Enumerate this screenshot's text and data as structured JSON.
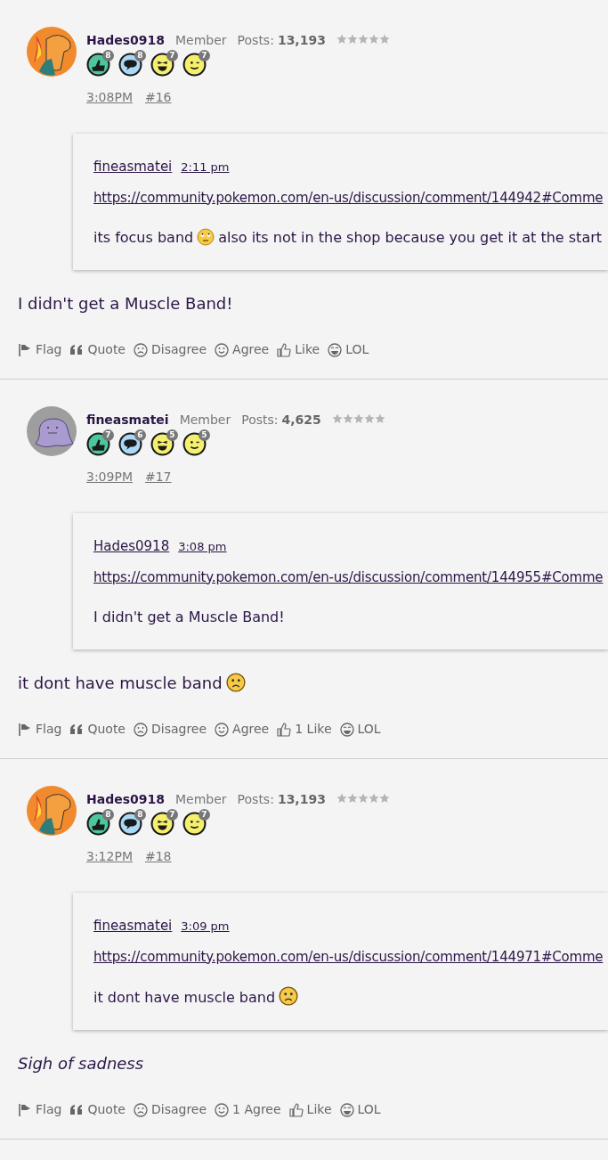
{
  "posts": [
    {
      "author": "Hades0918",
      "avatar": {
        "kind": "dragon"
      },
      "role": "Member",
      "posts_label": "Posts:",
      "posts_count": "13,193",
      "stars": 0,
      "badges": [
        {
          "kind": "thumb",
          "count": "8"
        },
        {
          "kind": "chat",
          "count": "8"
        },
        {
          "kind": "laugh",
          "count": "7"
        },
        {
          "kind": "wink",
          "count": "7"
        }
      ],
      "time": "3:08PM",
      "number": "#16",
      "quote": {
        "author": "fineasmatei",
        "time": "2:11 pm",
        "link": "https://community.pokemon.com/en-us/discussion/comment/144942#Comme",
        "segments": [
          {
            "kind": "text",
            "text": "its focus band"
          },
          {
            "kind": "eyeroll"
          },
          {
            "kind": "text",
            "text": "also its not in the shop because you get it at the start"
          }
        ]
      },
      "body": {
        "italic": false,
        "segments": [
          {
            "kind": "text",
            "text": "I didn't get a Muscle Band!"
          }
        ]
      },
      "actions": [
        {
          "kind": "flag",
          "label": "Flag"
        },
        {
          "kind": "quote",
          "label": "Quote"
        },
        {
          "kind": "disagree",
          "label": "Disagree"
        },
        {
          "kind": "agree",
          "label": "Agree"
        },
        {
          "kind": "like",
          "label": "Like"
        },
        {
          "kind": "lol",
          "label": "LOL"
        }
      ]
    },
    {
      "author": "fineasmatei",
      "avatar": {
        "kind": "blob"
      },
      "role": "Member",
      "posts_label": "Posts:",
      "posts_count": "4,625",
      "stars": 0,
      "badges": [
        {
          "kind": "thumb",
          "count": "7"
        },
        {
          "kind": "chat",
          "count": "6"
        },
        {
          "kind": "laugh",
          "count": "5"
        },
        {
          "kind": "wink",
          "count": "5"
        }
      ],
      "time": "3:09PM",
      "number": "#17",
      "quote": {
        "author": "Hades0918",
        "time": "3:08 pm",
        "link": "https://community.pokemon.com/en-us/discussion/comment/144955#Comme",
        "segments": [
          {
            "kind": "text",
            "text": "I didn't get a Muscle Band!"
          }
        ]
      },
      "body": {
        "italic": false,
        "segments": [
          {
            "kind": "text",
            "text": "it dont have muscle band"
          },
          {
            "kind": "sad"
          }
        ]
      },
      "actions": [
        {
          "kind": "flag",
          "label": "Flag"
        },
        {
          "kind": "quote",
          "label": "Quote"
        },
        {
          "kind": "disagree",
          "label": "Disagree"
        },
        {
          "kind": "agree",
          "label": "Agree"
        },
        {
          "kind": "like",
          "label": "1 Like"
        },
        {
          "kind": "lol",
          "label": "LOL"
        }
      ]
    },
    {
      "author": "Hades0918",
      "avatar": {
        "kind": "dragon"
      },
      "role": "Member",
      "posts_label": "Posts:",
      "posts_count": "13,193",
      "stars": 0,
      "badges": [
        {
          "kind": "thumb",
          "count": "8"
        },
        {
          "kind": "chat",
          "count": "8"
        },
        {
          "kind": "laugh",
          "count": "7"
        },
        {
          "kind": "wink",
          "count": "7"
        }
      ],
      "time": "3:12PM",
      "number": "#18",
      "quote": {
        "author": "fineasmatei",
        "time": "3:09 pm",
        "link": "https://community.pokemon.com/en-us/discussion/comment/144971#Comme",
        "segments": [
          {
            "kind": "text",
            "text": "it dont have muscle band"
          },
          {
            "kind": "sad"
          }
        ]
      },
      "body": {
        "italic": true,
        "segments": [
          {
            "kind": "text",
            "text": "Sigh of sadness"
          }
        ]
      },
      "actions": [
        {
          "kind": "flag",
          "label": "Flag"
        },
        {
          "kind": "quote",
          "label": "Quote"
        },
        {
          "kind": "disagree",
          "label": "Disagree"
        },
        {
          "kind": "agree",
          "label": "1 Agree"
        },
        {
          "kind": "like",
          "label": "Like"
        },
        {
          "kind": "lol",
          "label": "LOL"
        }
      ]
    }
  ]
}
